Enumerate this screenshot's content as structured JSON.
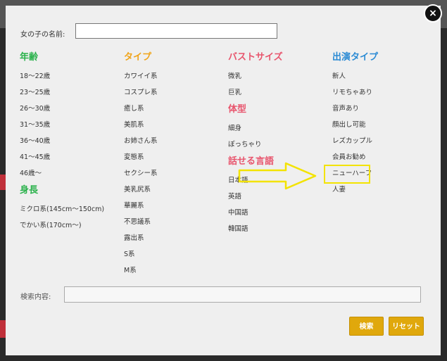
{
  "modal": {
    "close_icon": "×",
    "name_label": "女の子の名前:",
    "search_label": "検索内容:",
    "search_button": "検索",
    "reset_button": "リセット"
  },
  "columns": [
    {
      "key": "age",
      "color": "#2bb24c",
      "groups": [
        {
          "title": "年齢",
          "items": [
            "18〜22歳",
            "23〜25歳",
            "26〜30歳",
            "31〜35歳",
            "36〜40歳",
            "41〜45歳",
            "46歳〜"
          ]
        },
        {
          "title": "身長",
          "items": [
            "ミクロ系(145cm〜150cm)",
            "でかい系(170cm〜)"
          ]
        }
      ]
    },
    {
      "key": "type",
      "color": "#f0a418",
      "groups": [
        {
          "title": "タイプ",
          "items": [
            "カワイイ系",
            "コスプレ系",
            "癒し系",
            "美肌系",
            "お姉さん系",
            "変態系",
            "セクシー系",
            "美乳尻系",
            "華麗系",
            "不思議系",
            "露出系",
            "S系",
            "M系"
          ]
        }
      ]
    },
    {
      "key": "bust",
      "color": "#e8556d",
      "groups": [
        {
          "title": "バストサイズ",
          "items": [
            "微乳",
            "巨乳"
          ]
        },
        {
          "title": "体型",
          "items": [
            "細身",
            "ぽっちゃり"
          ]
        },
        {
          "title": "話せる言語",
          "items": [
            "日本語",
            "英語",
            "中国語",
            "韓国語"
          ]
        }
      ]
    },
    {
      "key": "appearance",
      "color": "#2a8ad4",
      "groups": [
        {
          "title": "出演タイプ",
          "items": [
            "新人",
            "リモちゃあり",
            "音声あり",
            "顔出し可能",
            "レズカップル",
            "会員お勧め",
            "ニューハーフ",
            "人妻"
          ]
        }
      ]
    }
  ]
}
